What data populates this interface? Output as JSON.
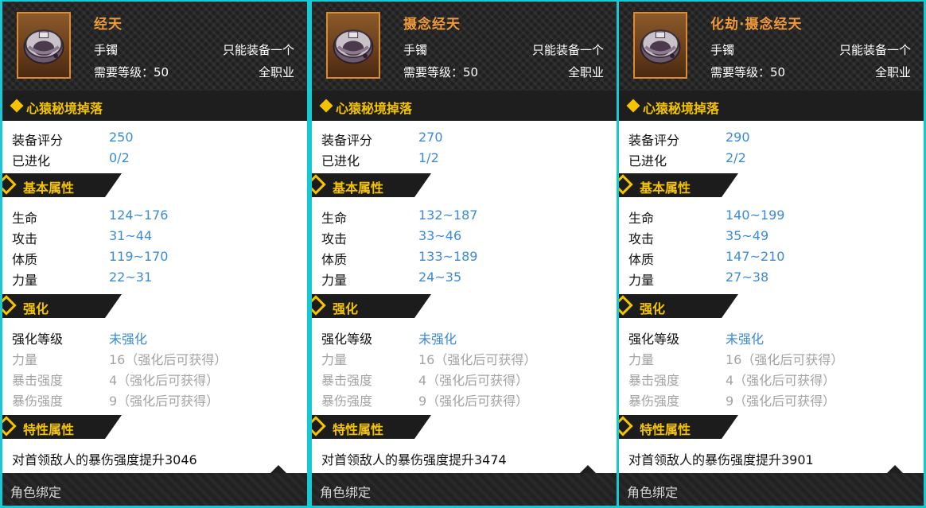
{
  "colors": {
    "frame": "#16c9d2",
    "item_name": "#f29a35",
    "accent_yellow": "#f5c400",
    "value_blue": "#3b8ad8",
    "dim_gray": "#a3a3a3"
  },
  "items": [
    {
      "name": "经天",
      "type": "手镯",
      "unique": "只能装备一个",
      "level": "需要等级：50",
      "profession": "全职业",
      "source": "心猿秘境掉落",
      "score_label": "装备评分",
      "score": "250",
      "evolve_label": "已进化",
      "evolve": "0/2",
      "base_title": "基本属性",
      "stats": [
        {
          "label": "生命",
          "value": "124~176"
        },
        {
          "label": "攻击",
          "value": "31~44"
        },
        {
          "label": "体质",
          "value": "119~170"
        },
        {
          "label": "力量",
          "value": "22~31"
        }
      ],
      "enhance_title": "强化",
      "enhance_level_label": "强化等级",
      "enhance_level": "未强化",
      "enhance_stats": [
        {
          "label": "力量",
          "value": "16（强化后可获得）"
        },
        {
          "label": "暴击强度",
          "value": "4（强化后可获得）"
        },
        {
          "label": "暴伤强度",
          "value": "9（强化后可获得）"
        }
      ],
      "trait_title": "特性属性",
      "trait": "对首领敌人的暴伤强度提升3046",
      "bind": "角色绑定"
    },
    {
      "name": "摄念经天",
      "type": "手镯",
      "unique": "只能装备一个",
      "level": "需要等级：50",
      "profession": "全职业",
      "source": "心猿秘境掉落",
      "score_label": "装备评分",
      "score": "270",
      "evolve_label": "已进化",
      "evolve": "1/2",
      "base_title": "基本属性",
      "stats": [
        {
          "label": "生命",
          "value": "132~187"
        },
        {
          "label": "攻击",
          "value": "33~46"
        },
        {
          "label": "体质",
          "value": "133~189"
        },
        {
          "label": "力量",
          "value": "24~35"
        }
      ],
      "enhance_title": "强化",
      "enhance_level_label": "强化等级",
      "enhance_level": "未强化",
      "enhance_stats": [
        {
          "label": "力量",
          "value": "16（强化后可获得）"
        },
        {
          "label": "暴击强度",
          "value": "4（强化后可获得）"
        },
        {
          "label": "暴伤强度",
          "value": "9（强化后可获得）"
        }
      ],
      "trait_title": "特性属性",
      "trait": "对首领敌人的暴伤强度提升3474",
      "bind": "角色绑定"
    },
    {
      "name": "化劫·摄念经天",
      "type": "手镯",
      "unique": "只能装备一个",
      "level": "需要等级：50",
      "profession": "全职业",
      "source": "心猿秘境掉落",
      "score_label": "装备评分",
      "score": "290",
      "evolve_label": "已进化",
      "evolve": "2/2",
      "base_title": "基本属性",
      "stats": [
        {
          "label": "生命",
          "value": "140~199"
        },
        {
          "label": "攻击",
          "value": "35~49"
        },
        {
          "label": "体质",
          "value": "147~210"
        },
        {
          "label": "力量",
          "value": "27~38"
        }
      ],
      "enhance_title": "强化",
      "enhance_level_label": "强化等级",
      "enhance_level": "未强化",
      "enhance_stats": [
        {
          "label": "力量",
          "value": "16（强化后可获得）"
        },
        {
          "label": "暴击强度",
          "value": "4（强化后可获得）"
        },
        {
          "label": "暴伤强度",
          "value": "9（强化后可获得）"
        }
      ],
      "trait_title": "特性属性",
      "trait": "对首领敌人的暴伤强度提升3901",
      "bind": "角色绑定"
    }
  ]
}
